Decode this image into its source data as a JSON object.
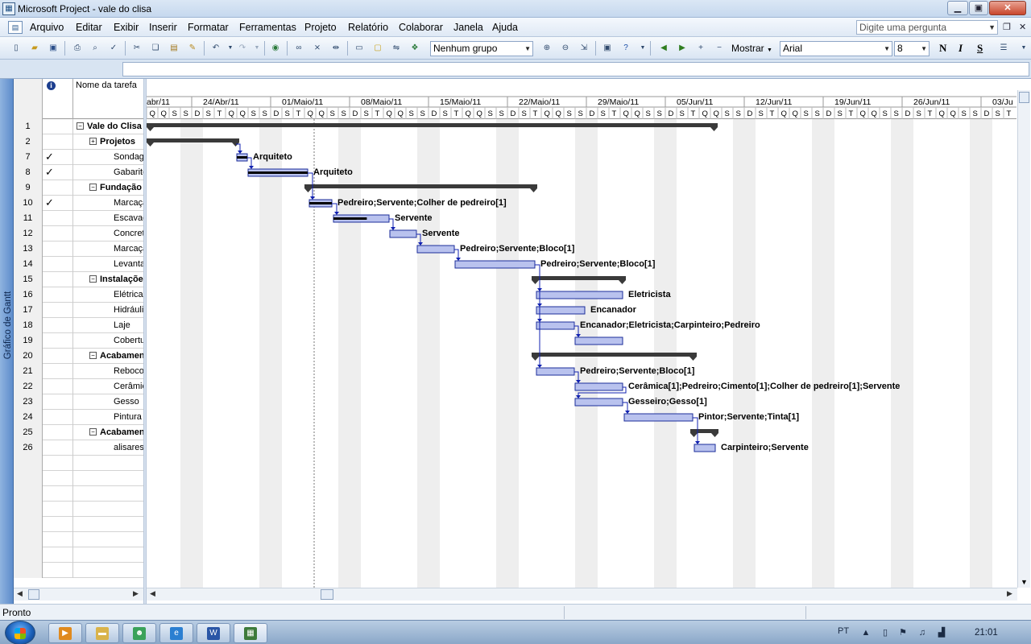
{
  "window": {
    "title": "Microsoft Project - vale do clisa",
    "min_label": "▁",
    "max_label": "▣",
    "close_label": "✕"
  },
  "menu": {
    "items": [
      "Arquivo",
      "Editar",
      "Exibir",
      "Inserir",
      "Formatar",
      "Ferramentas",
      "Projeto",
      "Relatório",
      "Colaborar",
      "Janela",
      "Ajuda"
    ],
    "help_placeholder": "Digite uma pergunta"
  },
  "toolbar": {
    "group_combo": "Nenhum grupo",
    "show_label": "Mostrar",
    "font_combo": "Arial",
    "size_combo": "8",
    "bold": "N",
    "italic": "I",
    "underline": "S"
  },
  "view_bar": {
    "label": "Gráfico de Gantt"
  },
  "table": {
    "name_header": "Nome da tarefa",
    "rows": [
      {
        "id": "1",
        "check": "",
        "name": "Vale do Clisa",
        "summary": true,
        "toggle": "−"
      },
      {
        "id": "2",
        "check": "",
        "name": "Projetos",
        "summary": true,
        "toggle": "+"
      },
      {
        "id": "7",
        "check": "✓",
        "name": "Sondagem",
        "summary": false,
        "toggle": ""
      },
      {
        "id": "8",
        "check": "✓",
        "name": "Gabarito",
        "summary": false,
        "toggle": ""
      },
      {
        "id": "9",
        "check": "",
        "name": "Fundação",
        "summary": true,
        "toggle": "−"
      },
      {
        "id": "10",
        "check": "✓",
        "name": "Marcação",
        "summary": false,
        "toggle": ""
      },
      {
        "id": "11",
        "check": "",
        "name": "Escavação",
        "summary": false,
        "toggle": ""
      },
      {
        "id": "12",
        "check": "",
        "name": "Concreto",
        "summary": false,
        "toggle": ""
      },
      {
        "id": "13",
        "check": "",
        "name": "Marcação",
        "summary": false,
        "toggle": ""
      },
      {
        "id": "14",
        "check": "",
        "name": "Levantamento",
        "summary": false,
        "toggle": ""
      },
      {
        "id": "15",
        "check": "",
        "name": "Instalações",
        "summary": true,
        "toggle": "−"
      },
      {
        "id": "16",
        "check": "",
        "name": "Elétrica",
        "summary": false,
        "toggle": ""
      },
      {
        "id": "17",
        "check": "",
        "name": "Hidráulica",
        "summary": false,
        "toggle": ""
      },
      {
        "id": "18",
        "check": "",
        "name": "Laje",
        "summary": false,
        "toggle": ""
      },
      {
        "id": "19",
        "check": "",
        "name": "Cobertura",
        "summary": false,
        "toggle": ""
      },
      {
        "id": "20",
        "check": "",
        "name": "Acabamento",
        "summary": true,
        "toggle": "−"
      },
      {
        "id": "21",
        "check": "",
        "name": "Reboco",
        "summary": false,
        "toggle": ""
      },
      {
        "id": "22",
        "check": "",
        "name": "Cerâmica",
        "summary": false,
        "toggle": ""
      },
      {
        "id": "23",
        "check": "",
        "name": "Gesso",
        "summary": false,
        "toggle": ""
      },
      {
        "id": "24",
        "check": "",
        "name": "Pintura",
        "summary": false,
        "toggle": ""
      },
      {
        "id": "25",
        "check": "",
        "name": "Acabamento",
        "summary": true,
        "toggle": "−"
      },
      {
        "id": "26",
        "check": "",
        "name": "alisares",
        "summary": false,
        "toggle": ""
      }
    ]
  },
  "timescale": {
    "weeks": [
      "abr/11",
      "24/Abr/11",
      "01/Maio/11",
      "08/Maio/11",
      "15/Maio/11",
      "22/Maio/11",
      "29/Maio/11",
      "05/Jun/11",
      "12/Jun/11",
      "19/Jun/11",
      "26/Jun/11",
      "03/Ju"
    ],
    "day_letters": [
      "D",
      "S",
      "T",
      "Q",
      "Q",
      "S",
      "S"
    ]
  },
  "gantt": {
    "bars": [
      {
        "row": 0,
        "type": "summary",
        "start": 0,
        "end": 709
      },
      {
        "row": 1,
        "type": "summary",
        "start": 0,
        "end": 115
      },
      {
        "row": 2,
        "type": "task",
        "start": 112,
        "end": 125,
        "done": 1.0,
        "label": "Arquiteto"
      },
      {
        "row": 3,
        "type": "task",
        "start": 126,
        "end": 200,
        "done": 1.0,
        "label": "Arquiteto"
      },
      {
        "row": 4,
        "type": "summary",
        "start": 196,
        "end": 485
      },
      {
        "row": 5,
        "type": "task",
        "start": 202,
        "end": 230,
        "done": 1.0,
        "label": "Pedreiro;Servente;Colher de pedreiro[1]"
      },
      {
        "row": 6,
        "type": "task",
        "start": 232,
        "end": 301,
        "done": 0.6,
        "label": "Servente"
      },
      {
        "row": 7,
        "type": "task",
        "start": 302,
        "end": 335,
        "done": 0,
        "label": "Servente"
      },
      {
        "row": 8,
        "type": "task",
        "start": 336,
        "end": 382,
        "done": 0,
        "label": "Pedreiro;Servente;Bloco[1]"
      },
      {
        "row": 9,
        "type": "task",
        "start": 383,
        "end": 482,
        "done": 0,
        "label": "Pedreiro;Servente;Bloco[1]"
      },
      {
        "row": 10,
        "type": "summary",
        "start": 478,
        "end": 595
      },
      {
        "row": 11,
        "type": "task",
        "start": 484,
        "end": 591,
        "done": 0,
        "label": "Eletricista"
      },
      {
        "row": 12,
        "type": "task",
        "start": 484,
        "end": 544,
        "done": 0,
        "label": "Encanador"
      },
      {
        "row": 13,
        "type": "task",
        "start": 484,
        "end": 531,
        "done": 0,
        "label": "Encanador;Eletricista;Carpinteiro;Pedreiro"
      },
      {
        "row": 14,
        "type": "task",
        "start": 532,
        "end": 591,
        "done": 0,
        "label": ""
      },
      {
        "row": 15,
        "type": "summary",
        "start": 478,
        "end": 683
      },
      {
        "row": 16,
        "type": "task",
        "start": 484,
        "end": 531,
        "done": 0,
        "label": "Pedreiro;Servente;Bloco[1]"
      },
      {
        "row": 17,
        "type": "task",
        "start": 532,
        "end": 591,
        "done": 0,
        "label": "Cerâmica[1];Pedreiro;Cimento[1];Colher de pedreiro[1];Servente"
      },
      {
        "row": 18,
        "type": "task",
        "start": 532,
        "end": 591,
        "done": 0,
        "label": "Gesseiro;Gesso[1]"
      },
      {
        "row": 19,
        "type": "task",
        "start": 593,
        "end": 678,
        "done": 0,
        "label": "Pintor;Servente;Tinta[1]"
      },
      {
        "row": 20,
        "type": "summary",
        "start": 675,
        "end": 710
      },
      {
        "row": 21,
        "type": "task",
        "start": 680,
        "end": 706,
        "done": 0,
        "label": "Carpinteiro;Servente"
      }
    ]
  },
  "status": {
    "text": "Pronto"
  },
  "tray": {
    "lang": "PT",
    "clock": "21:01"
  },
  "colors": {
    "task_fill": "#b9c2ee",
    "task_border": "#1c2d9a",
    "summary": "#3a3a3a",
    "link": "#1020b0",
    "nonworking": "#e0e0e0"
  }
}
